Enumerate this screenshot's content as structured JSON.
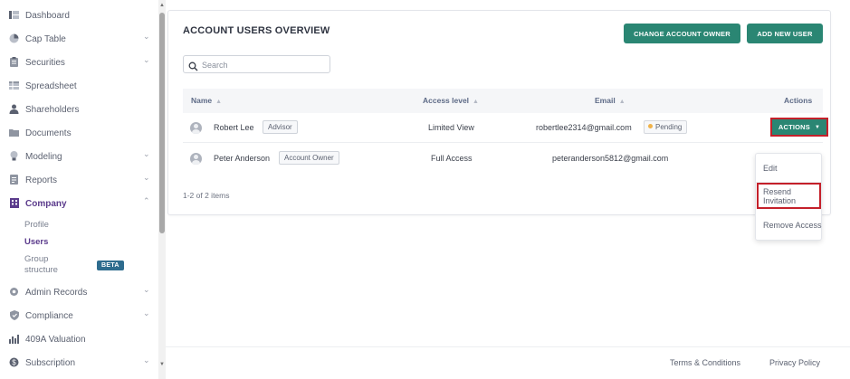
{
  "sidebar": {
    "items": [
      {
        "label": "Dashboard",
        "icon": "dashboard-icon"
      },
      {
        "label": "Cap Table",
        "icon": "pie-chart-icon"
      },
      {
        "label": "Securities",
        "icon": "clipboard-icon"
      },
      {
        "label": "Spreadsheet",
        "icon": "table-icon"
      },
      {
        "label": "Shareholders",
        "icon": "person-icon"
      },
      {
        "label": "Documents",
        "icon": "folder-icon"
      },
      {
        "label": "Modeling",
        "icon": "bulb-icon"
      },
      {
        "label": "Reports",
        "icon": "report-icon"
      },
      {
        "label": "Company",
        "icon": "building-icon"
      },
      {
        "label": "Admin Records",
        "icon": "gear-icon"
      },
      {
        "label": "Compliance",
        "icon": "shield-icon"
      },
      {
        "label": "409A Valuation",
        "icon": "chart-icon"
      },
      {
        "label": "Subscription",
        "icon": "dollar-icon"
      }
    ],
    "company_sub": {
      "profile": "Profile",
      "users": "Users",
      "group_structure_line1": "Group",
      "group_structure_line2": "structure",
      "beta": "BETA"
    }
  },
  "card": {
    "title": "ACCOUNT USERS OVERVIEW",
    "change_owner_label": "CHANGE ACCOUNT OWNER",
    "add_user_label": "ADD NEW USER",
    "search_placeholder": "Search",
    "columns": {
      "name": "Name",
      "access": "Access level",
      "email": "Email",
      "actions": "Actions"
    },
    "rows": [
      {
        "name": "Robert Lee",
        "role": "Advisor",
        "access": "Limited View",
        "email": "robertlee2314@gmail.com",
        "status": "Pending"
      },
      {
        "name": "Peter Anderson",
        "role": "Account Owner",
        "access": "Full Access",
        "email": "peteranderson5812@gmail.com"
      }
    ],
    "actions_label": "ACTIONS",
    "items_count": "1-2 of 2 items"
  },
  "dropdown": {
    "edit": "Edit",
    "resend": "Resend Invitation",
    "remove": "Remove Access"
  },
  "footer": {
    "terms": "Terms & Conditions",
    "privacy": "Privacy Policy"
  },
  "colors": {
    "accent_green": "#2a8673",
    "active_purple": "#5b3b8c",
    "highlight_red": "#c4202a",
    "pending_dot": "#f0b24a"
  }
}
